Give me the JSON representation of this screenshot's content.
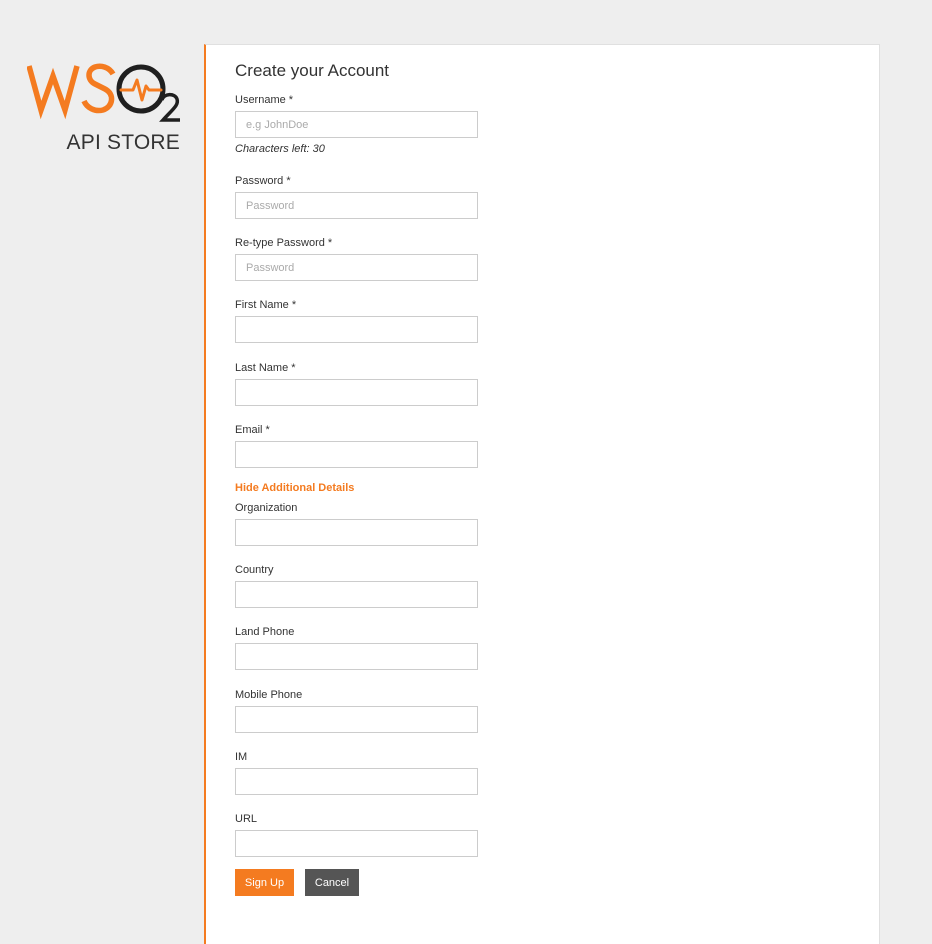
{
  "brand": {
    "logo_text": "WSO2",
    "product_name": "API STORE",
    "accent_color": "#f47b20"
  },
  "form": {
    "title": "Create your Account",
    "fields": {
      "username": {
        "label": "Username *",
        "placeholder": "e.g JohnDoe",
        "value": "",
        "helper": "Characters left: 30"
      },
      "password": {
        "label": "Password *",
        "placeholder": "Password",
        "value": ""
      },
      "retype_password": {
        "label": "Re-type Password *",
        "placeholder": "Password",
        "value": ""
      },
      "first_name": {
        "label": "First Name *",
        "placeholder": "",
        "value": ""
      },
      "last_name": {
        "label": "Last Name *",
        "placeholder": "",
        "value": ""
      },
      "email": {
        "label": "Email *",
        "placeholder": "",
        "value": ""
      },
      "organization": {
        "label": "Organization",
        "placeholder": "",
        "value": ""
      },
      "country": {
        "label": "Country",
        "placeholder": "",
        "value": ""
      },
      "land_phone": {
        "label": "Land Phone",
        "placeholder": "",
        "value": ""
      },
      "mobile_phone": {
        "label": "Mobile Phone",
        "placeholder": "",
        "value": ""
      },
      "im": {
        "label": "IM",
        "placeholder": "",
        "value": ""
      },
      "url": {
        "label": "URL",
        "placeholder": "",
        "value": ""
      }
    },
    "toggle_additional": "Hide Additional Details",
    "buttons": {
      "sign_up": "Sign Up",
      "cancel": "Cancel"
    }
  }
}
